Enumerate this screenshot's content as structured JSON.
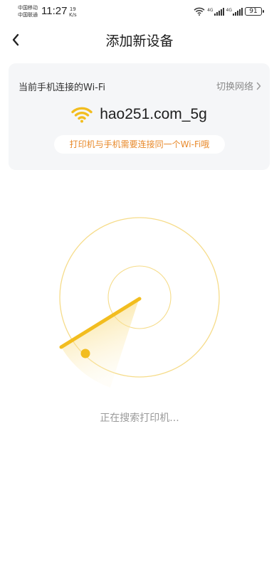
{
  "status_bar": {
    "carrier_1": "中国移动",
    "carrier_2": "中国联通",
    "time": "11:27",
    "net_speed_value": "19",
    "net_speed_unit": "K/s",
    "sig1_tag": "4G",
    "sig2_tag": "4G",
    "battery": "91"
  },
  "header": {
    "title": "添加新设备"
  },
  "wifi_card": {
    "label": "当前手机连接的Wi-Fi",
    "switch_label": "切换网络",
    "ssid": "hao251.com_5g",
    "hint": "打印机与手机需要连接同一个Wi-Fi哦"
  },
  "scan": {
    "status_text": "正在搜索打印机..."
  },
  "colors": {
    "accent": "#f2bd1f",
    "hint_text": "#e8892a",
    "card_bg": "#f5f6f8"
  }
}
